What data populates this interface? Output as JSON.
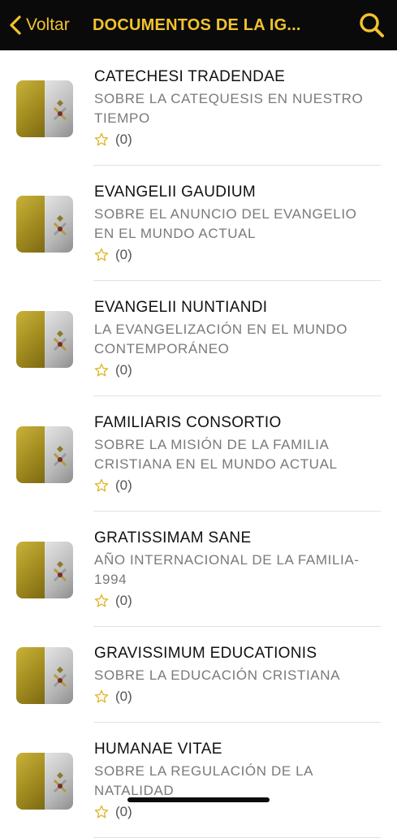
{
  "nav": {
    "back_label": "Voltar",
    "title": "DOCUMENTOS DE LA IG...",
    "accent_color": "#f2c22e",
    "background_color": "#0a0a0a"
  },
  "documents": [
    {
      "title": "CATECHESI TRADENDAE",
      "subtitle": "SOBRE LA CATEQUESIS EN NUESTRO TIEMPO",
      "rating": "(0)"
    },
    {
      "title": "EVANGELII GAUDIUM",
      "subtitle": "SOBRE EL ANUNCIO DEL EVANGELIO EN EL MUNDO ACTUAL",
      "rating": "(0)"
    },
    {
      "title": "EVANGELII NUNTIANDI",
      "subtitle": "LA EVANGELIZACIÓN EN EL MUNDO CONTEMPORÁNEO",
      "rating": "(0)"
    },
    {
      "title": "FAMILIARIS CONSORTIO",
      "subtitle": "SOBRE LA MISIÓN DE LA FAMILIA CRISTIANA EN EL MUNDO ACTUAL",
      "rating": "(0)"
    },
    {
      "title": "GRATISSIMAM SANE",
      "subtitle": "AÑO INTERNACIONAL DE LA FAMILIA-1994",
      "rating": "(0)"
    },
    {
      "title": "GRAVISSIMUM EDUCATIONIS",
      "subtitle": "SOBRE LA EDUCACIÓN CRISTIANA",
      "rating": "(0)"
    },
    {
      "title": "HUMANAE VITAE",
      "subtitle": "SOBRE LA REGULACIÓN DE LA NATALIDAD",
      "rating": "(0)"
    }
  ],
  "icons": {
    "back": "chevron-left-icon",
    "search": "search-icon",
    "star": "star-outline-icon",
    "thumbnail": "vatican-flag-icon"
  }
}
